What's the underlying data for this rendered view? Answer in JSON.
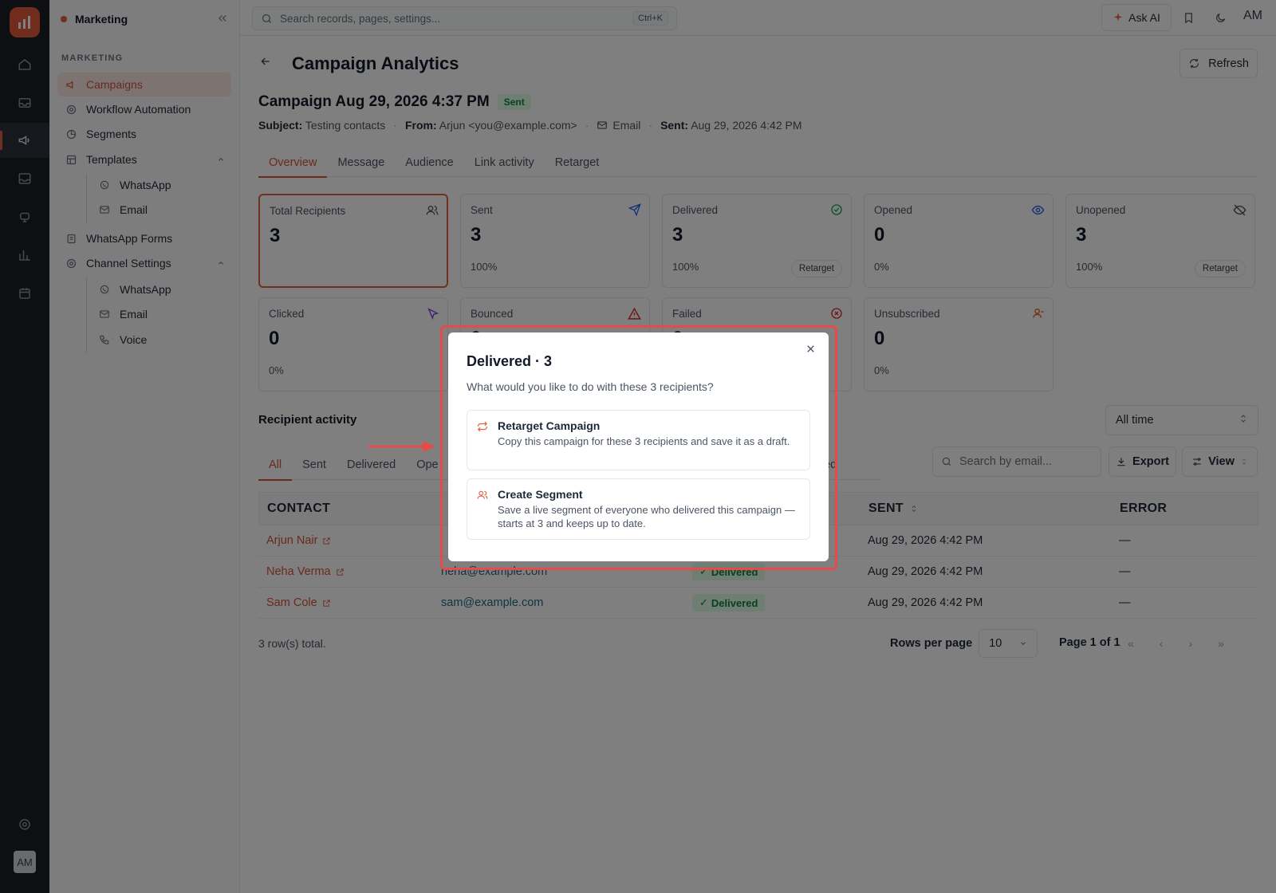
{
  "workspace": {
    "name": "Marketing"
  },
  "sidebar": {
    "section_label": "MARKETING",
    "items": [
      {
        "label": "Campaigns"
      },
      {
        "label": "Workflow Automation"
      },
      {
        "label": "Segments"
      },
      {
        "label": "Templates"
      },
      {
        "label": "WhatsApp"
      },
      {
        "label": "Email"
      },
      {
        "label": "WhatsApp Forms"
      },
      {
        "label": "Channel Settings"
      },
      {
        "label": "WhatsApp"
      },
      {
        "label": "Email"
      },
      {
        "label": "Voice"
      }
    ]
  },
  "topbar": {
    "search_placeholder": "Search records, pages, settings...",
    "shortcut": "Ctrl+K",
    "ask_ai": "Ask AI",
    "avatar": "AM"
  },
  "rail": {
    "avatar": "AM"
  },
  "page": {
    "title": "Campaign Analytics",
    "refresh": "Refresh",
    "campaign_title": "Campaign Aug 29, 2026 4:37 PM",
    "status": "Sent",
    "subject_label": "Subject:",
    "subject": "Testing contacts",
    "from_label": "From:",
    "from": "Arjun <you@example.com>",
    "channel": "Email",
    "sent_label": "Sent:",
    "sent_at": "Aug 29, 2026 4:42 PM",
    "tabs": [
      "Overview",
      "Message",
      "Audience",
      "Link activity",
      "Retarget"
    ]
  },
  "stats": [
    {
      "label": "Total Recipients",
      "value": "3",
      "pct": ""
    },
    {
      "label": "Sent",
      "value": "3",
      "pct": "100%"
    },
    {
      "label": "Delivered",
      "value": "3",
      "pct": "100%",
      "action": "Retarget"
    },
    {
      "label": "Opened",
      "value": "0",
      "pct": "0%"
    },
    {
      "label": "Unopened",
      "value": "3",
      "pct": "100%",
      "action": "Retarget"
    },
    {
      "label": "Clicked",
      "value": "0",
      "pct": "0%"
    },
    {
      "label": "Bounced",
      "value": "0",
      "pct": ""
    },
    {
      "label": "Failed",
      "value": "0",
      "pct": ""
    },
    {
      "label": "Unsubscribed",
      "value": "0",
      "pct": "0%"
    }
  ],
  "activity": {
    "title": "Recipient activity",
    "time_filter": "All time",
    "tabs": [
      "All",
      "Sent",
      "Delivered",
      "Ope"
    ],
    "tab_tail": "bed",
    "search_placeholder": "Search by email...",
    "export": "Export",
    "view": "View",
    "columns": [
      "CONTACT",
      "SENT",
      "ERROR"
    ],
    "rows": [
      {
        "name": "Arjun Nair",
        "email": "",
        "status": "",
        "sent": "Aug 29, 2026 4:42 PM",
        "error": "—"
      },
      {
        "name": "Neha Verma",
        "email": "neha@example.com",
        "status": "Delivered",
        "sent": "Aug 29, 2026 4:42 PM",
        "error": "—"
      },
      {
        "name": "Sam Cole",
        "email": "sam@example.com",
        "status": "Delivered",
        "sent": "Aug 29, 2026 4:42 PM",
        "error": "—"
      }
    ],
    "total": "3 row(s) total.",
    "rows_per_page_label": "Rows per page",
    "rows_per_page": "10",
    "page_of": "Page 1 of 1"
  },
  "modal": {
    "title": "Delivered · 3",
    "subtitle": "What would you like to do with these 3 recipients?",
    "options": [
      {
        "title": "Retarget Campaign",
        "desc": "Copy this campaign for these 3 recipients and save it as a draft."
      },
      {
        "title": "Create Segment",
        "desc": "Save a live segment of everyone who delivered this campaign — starts at 3 and keeps up to date."
      }
    ]
  },
  "colors": {
    "accent": "#d2543a",
    "highlight": "#e84a4a",
    "rail": "#1b1f27"
  }
}
